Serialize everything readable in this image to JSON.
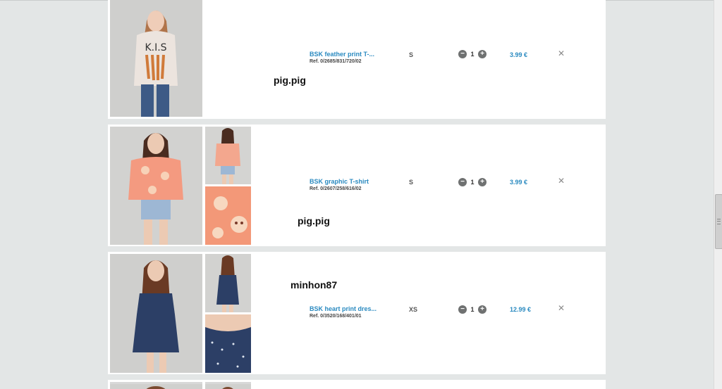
{
  "cart": {
    "items": [
      {
        "name": "BSK feather print T-...",
        "ref": "Ref. 0/2685/831/720/02",
        "size": "S",
        "quantity": "1",
        "price": "3.99 €",
        "username": "pig.pig"
      },
      {
        "name": "BSK graphic T-shirt",
        "ref": "Ref. 0/2607/258/616/02",
        "size": "S",
        "quantity": "1",
        "price": "3.99 €",
        "username": "pig.pig"
      },
      {
        "name": "BSK heart print dres...",
        "ref": "Ref. 0/3520/168/401/01",
        "size": "XS",
        "quantity": "1",
        "price": "12.99 €",
        "username": "minhon87"
      }
    ],
    "icons": {
      "decrease": "minus-circle-icon",
      "increase": "plus-circle-icon",
      "remove": "close-icon"
    },
    "colors": {
      "link": "#2a8ac0",
      "background": "#e3e6e6",
      "card": "#ffffff"
    }
  }
}
